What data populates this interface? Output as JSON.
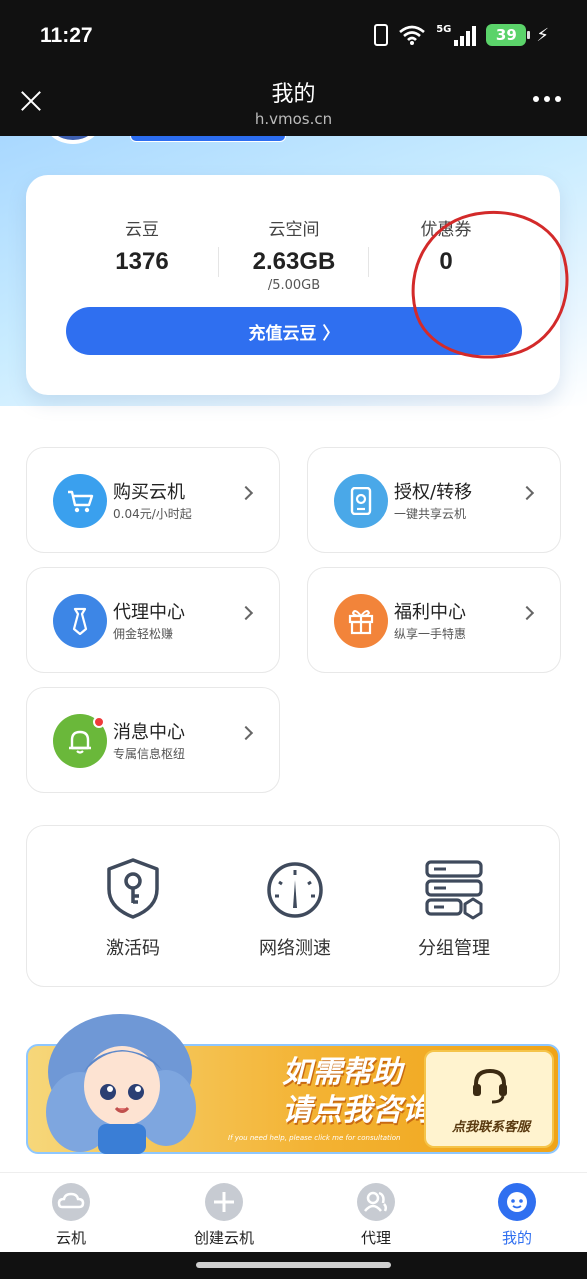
{
  "status_bar": {
    "time": "11:27",
    "network": "5G",
    "battery": "39"
  },
  "header": {
    "title": "我的",
    "url": "h.vmos.cn"
  },
  "stats": {
    "beans": {
      "label": "云豆",
      "value": "1376"
    },
    "space": {
      "label": "云空间",
      "value": "2.63GB",
      "total": "/5.00GB"
    },
    "coupons": {
      "label": "优惠券",
      "value": "0"
    },
    "recharge_label": "充值云豆 〉"
  },
  "menu": [
    {
      "title": "购买云机",
      "subtitle": "0.04元/小时起",
      "icon": "cart-icon",
      "color": "#3aa0ee"
    },
    {
      "title": "授权/转移",
      "subtitle": "一键共享云机",
      "icon": "phone-share-icon",
      "color": "#4aa8e8"
    },
    {
      "title": "代理中心",
      "subtitle": "佣金轻松赚",
      "icon": "tie-icon",
      "color": "#3d86e6"
    },
    {
      "title": "福利中心",
      "subtitle": "纵享一手特惠",
      "icon": "gift-icon",
      "color": "#f2843a"
    },
    {
      "title": "消息中心",
      "subtitle": "专属信息枢纽",
      "icon": "bell-icon",
      "color": "#6ab83a"
    }
  ],
  "tools": [
    {
      "label": "激活码",
      "icon": "key-shield-icon"
    },
    {
      "label": "网络测速",
      "icon": "speedometer-icon"
    },
    {
      "label": "分组管理",
      "icon": "server-group-icon"
    }
  ],
  "banner": {
    "line1": "如需帮助",
    "line2": "请点我咨询",
    "small": "If you need help, please click me for consultation",
    "button": "点我联系客服"
  },
  "nav": [
    {
      "label": "云机",
      "icon": "cloud-phone-icon",
      "active": false
    },
    {
      "label": "创建云机",
      "icon": "plus-icon",
      "active": false
    },
    {
      "label": "代理",
      "icon": "agent-icon",
      "active": false
    },
    {
      "label": "我的",
      "icon": "profile-icon",
      "active": true
    }
  ]
}
